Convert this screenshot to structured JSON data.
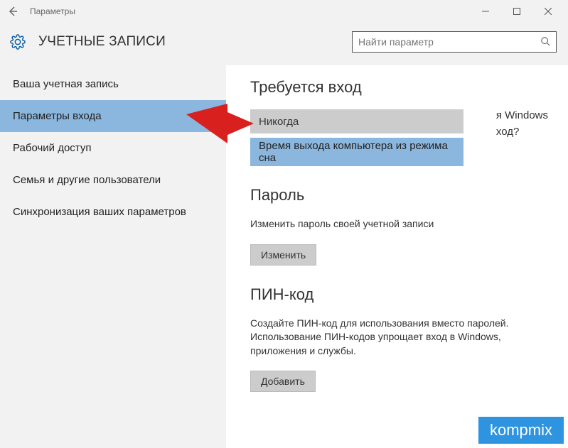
{
  "titlebar": {
    "title": "Параметры"
  },
  "header": {
    "title": "УЧЕТНЫЕ ЗАПИСИ",
    "search_placeholder": "Найти параметр"
  },
  "sidebar": {
    "items": [
      {
        "label": "Ваша учетная запись"
      },
      {
        "label": "Параметры входа"
      },
      {
        "label": "Рабочий доступ"
      },
      {
        "label": "Семья и другие пользователи"
      },
      {
        "label": "Синхронизация ваших параметров"
      }
    ]
  },
  "content": {
    "signin": {
      "title": "Требуется вход",
      "hint_right1": "я Windows",
      "hint_right2": "ход?",
      "selected": "Никогда",
      "option": "Время выхода компьютера из режима сна"
    },
    "password": {
      "title": "Пароль",
      "hint": "Изменить пароль своей учетной записи",
      "button": "Изменить"
    },
    "pin": {
      "title": "ПИН-код",
      "hint": "Создайте ПИН-код для использования вместо паролей. Использование ПИН-кодов упрощает вход в Windows, приложения и службы.",
      "button": "Добавить"
    }
  },
  "watermark": "kompmix"
}
